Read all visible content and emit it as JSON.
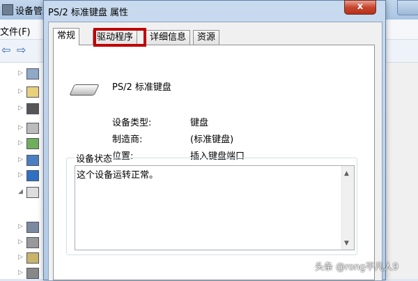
{
  "background_window": {
    "title": "设备管理",
    "menu_file": "文件(F)"
  },
  "dialog": {
    "title": "PS/2 标准键盘 属性",
    "close_label": "x",
    "tabs": [
      "常规",
      "驱动程序",
      "详细信息",
      "资源"
    ],
    "active_tab": "常规",
    "highlighted_tab": "驱动程序",
    "device_name": "PS/2 标准键盘",
    "properties": [
      {
        "label": "设备类型:",
        "value": "键盘"
      },
      {
        "label": "制造商:",
        "value": "(标准键盘)"
      },
      {
        "label": "位置:",
        "value": "插入键盘端口"
      }
    ],
    "status_group_label": "设备状态",
    "status_text": "这个设备运转正常。"
  },
  "watermark": "头条 @rong平凡人9",
  "colors": {
    "highlight_border": "#c00000",
    "close_button": "#c7472e"
  }
}
